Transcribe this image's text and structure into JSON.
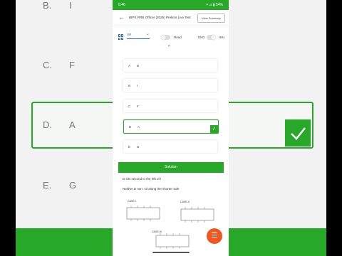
{
  "background": {
    "rows": [
      {
        "key": "B.",
        "value": "I"
      },
      {
        "key": "C.",
        "value": "F"
      },
      {
        "key": "D.",
        "value": "A"
      },
      {
        "key": "E.",
        "value": "G"
      }
    ]
  },
  "status_bar": {
    "time": "9:46",
    "right": "▾ ⊿ ▮ 54%"
  },
  "header": {
    "title": "IBPS RRB Officer (2025) Prelims Live Test",
    "view_button": "View Summary"
  },
  "toolbar": {
    "language": "UR",
    "toggle1_label": "Read",
    "toggle2_label": "ENG",
    "toggle2_right": "HIN"
  },
  "options": [
    {
      "key": "A",
      "value": "B"
    },
    {
      "key": "B",
      "value": "I"
    },
    {
      "key": "C",
      "value": "F"
    },
    {
      "key": "D",
      "value": "A",
      "selected": true
    },
    {
      "key": "E",
      "value": "D"
    }
  ],
  "solution": {
    "button_label": "Solution",
    "line1": "D sits second to the left of I.",
    "line2": "Neither D nor I sit along the shorter side",
    "case_labels": [
      "CASE-I",
      "CASE-II",
      "CASE-III"
    ]
  },
  "colors": {
    "accent": "#28a828",
    "fab": "#f2561f",
    "link": "#2f6ebf"
  },
  "icons": {
    "back": "back-arrow-icon",
    "grid": "grid-icon",
    "check": "check-icon",
    "fab": "list-icon"
  }
}
